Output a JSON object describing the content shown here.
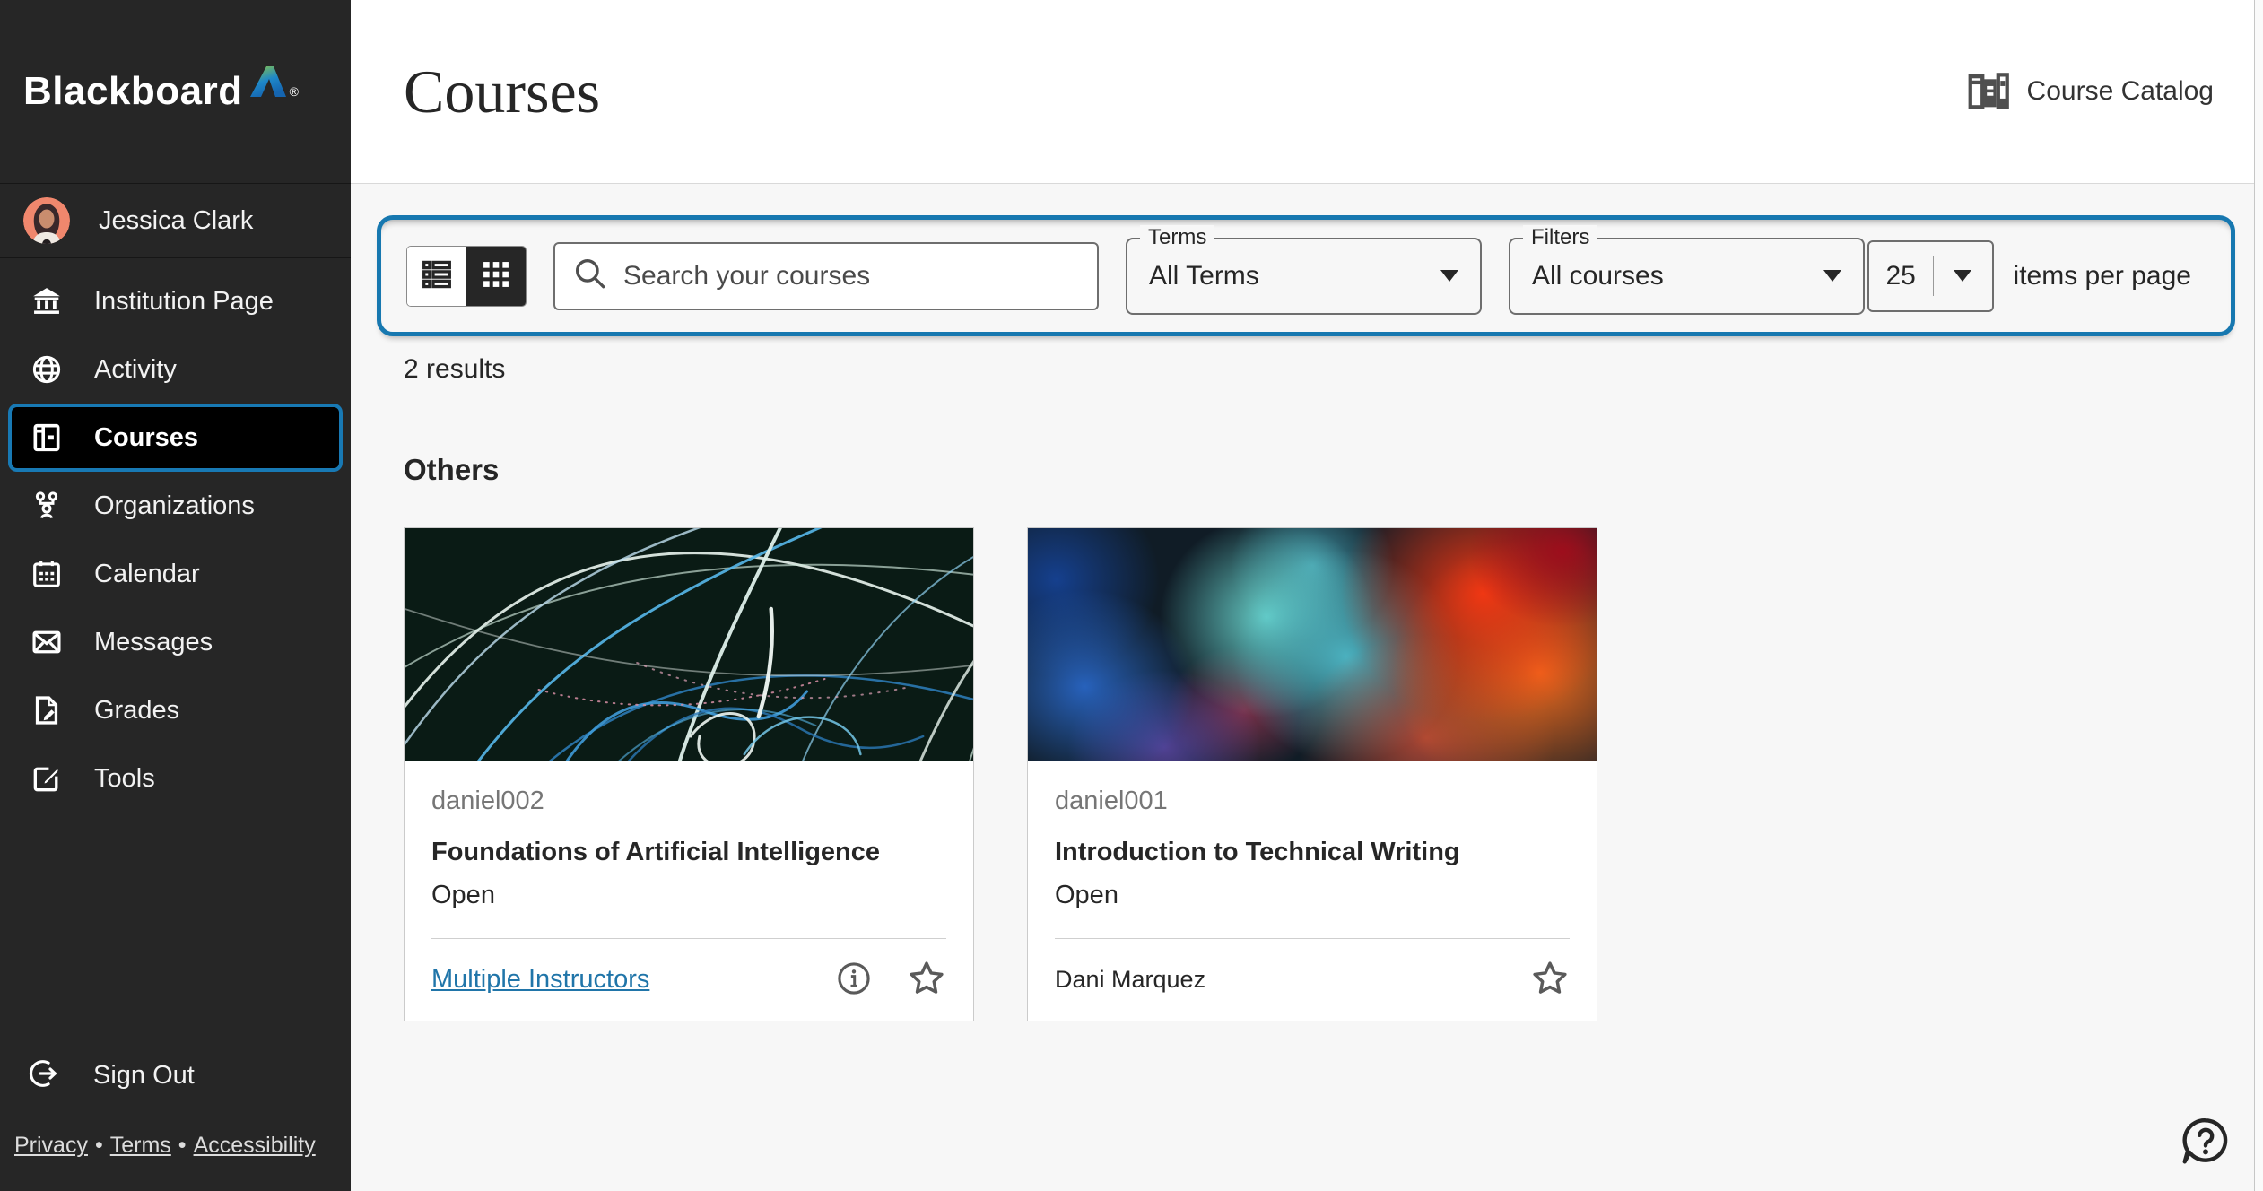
{
  "colors": {
    "sidebar_bg": "#262626",
    "selected_bg": "#000000",
    "accent_blue": "#1778b0",
    "link_blue": "#2075a9",
    "content_bg": "#f7f7f7",
    "text_dark": "#262626",
    "text_gray": "#767676"
  },
  "icons": {
    "logo_mark": "blackboard-arrow",
    "list_view": "list-view-icon",
    "grid_view": "grid-view-icon",
    "search": "magnifier",
    "chevron": "chevron-down",
    "info": "info-circle",
    "favorite": "star-outline",
    "help": "question-bubble"
  },
  "sidebar": {
    "logo": "Blackboard",
    "logo_reg": "®",
    "user": {
      "name": "Jessica Clark"
    },
    "items": [
      {
        "label": "Institution Page",
        "icon": "institution-icon",
        "selected": false
      },
      {
        "label": "Activity",
        "icon": "activity-globe-icon",
        "selected": false
      },
      {
        "label": "Courses",
        "icon": "courses-journal-icon",
        "selected": true
      },
      {
        "label": "Organizations",
        "icon": "organizations-icon",
        "selected": false
      },
      {
        "label": "Calendar",
        "icon": "calendar-icon",
        "selected": false
      },
      {
        "label": "Messages",
        "icon": "messages-envelope-icon",
        "selected": false
      },
      {
        "label": "Grades",
        "icon": "grades-icon",
        "selected": false
      },
      {
        "label": "Tools",
        "icon": "tools-pencil-icon",
        "selected": false
      }
    ],
    "sign_out": "Sign Out",
    "footer_separator": "•",
    "footer_links": [
      "Privacy",
      "Terms",
      "Accessibility"
    ]
  },
  "header": {
    "title": "Courses",
    "catalog_label": "Course Catalog"
  },
  "filter_bar": {
    "search_placeholder": "Search your courses",
    "terms_label": "Terms",
    "terms_value": "All Terms",
    "filters_label": "Filters",
    "filters_value": "All courses",
    "page_size": "25",
    "items_per_page_label": "items per page"
  },
  "results": {
    "count_text": "2 results",
    "group_title": "Others"
  },
  "courses": [
    {
      "code": "daniel002",
      "title": "Foundations of Artificial Intelligence",
      "status": "Open",
      "instructor": "Multiple Instructors",
      "image_desc": "dark long-exposure light trails"
    },
    {
      "code": "daniel001",
      "title": "Introduction to Technical Writing",
      "status": "Open",
      "instructor": "Dani Marquez",
      "image_desc": "colorful ink in water"
    }
  ]
}
